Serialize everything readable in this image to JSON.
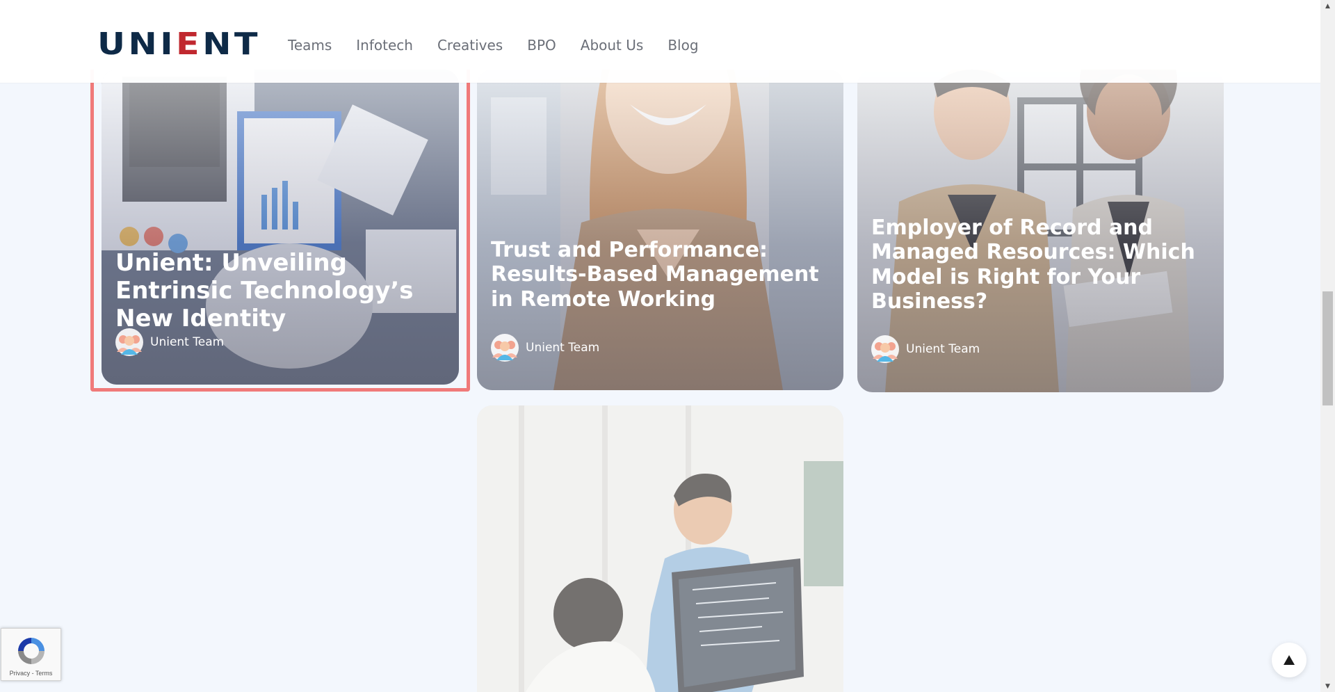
{
  "header": {
    "logo_text_a": "UNI",
    "logo_text_accent": "E",
    "logo_text_b": "NT",
    "nav": [
      {
        "label": "Teams"
      },
      {
        "label": "Infotech"
      },
      {
        "label": "Creatives"
      },
      {
        "label": "BPO"
      },
      {
        "label": "About Us"
      },
      {
        "label": "Blog"
      }
    ]
  },
  "posts": [
    {
      "title": "Unient: Unveiling Entrinsic Technology’s New Identity",
      "author": "Unient Team"
    },
    {
      "title": "Trust and Performance: Results-Based Management in Remote Working",
      "author": "Unient Team"
    },
    {
      "title": "Employer of Record and Managed Resources: Which Model is Right for Your Business?",
      "author": "Unient Team"
    }
  ],
  "recaptcha": {
    "links": "Privacy - Terms"
  },
  "colors": {
    "brand_navy": "#0e2a47",
    "brand_red": "#c0282f",
    "highlight": "#f07a7a",
    "page_bg": "#f3f7fd"
  },
  "icons": {
    "back_to_top": "triangle-up-icon",
    "avatar": "team-avatar-icon"
  }
}
